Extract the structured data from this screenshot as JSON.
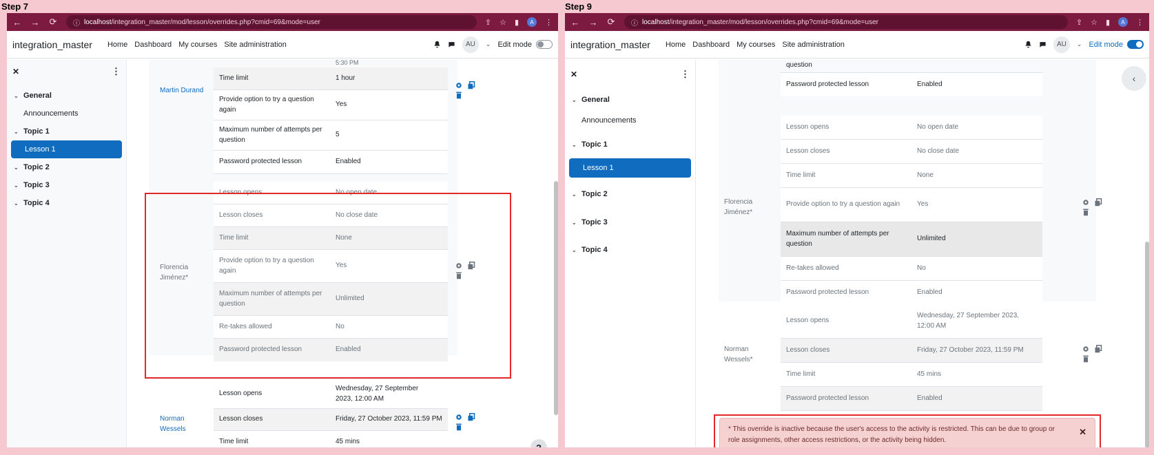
{
  "steps": [
    {
      "label": "Step 7",
      "url": {
        "host": "localhost",
        "path": "/integration_master/mod/lesson/overrides.php?cmid=69&mode=user"
      },
      "profile_initial": "A",
      "nav": {
        "site_name": "integration_master",
        "links": [
          "Home",
          "Dashboard",
          "My courses",
          "Site administration"
        ],
        "user_initials": "AU",
        "edit_mode_label": "Edit mode",
        "edit_mode_on": false
      },
      "drawer": {
        "close_glyph": "✕",
        "kebab_glyph": "⋮",
        "items": [
          {
            "label": "General",
            "type": "section"
          },
          {
            "label": "Announcements",
            "type": "child"
          },
          {
            "label": "Topic 1",
            "type": "section"
          },
          {
            "label": "Lesson 1",
            "type": "active"
          },
          {
            "label": "Topic 2",
            "type": "section"
          },
          {
            "label": "Topic 3",
            "type": "section"
          },
          {
            "label": "Topic 4",
            "type": "section"
          }
        ]
      },
      "top_fragment": "5:30 PM",
      "martin": {
        "name": "Martin Durand",
        "rows": [
          {
            "label": "Time limit",
            "value": "1 hour"
          },
          {
            "label": "Provide option to try a question again",
            "value": "Yes"
          },
          {
            "label": "Maximum number of attempts per question",
            "value": "5"
          },
          {
            "label": "Password protected lesson",
            "value": "Enabled"
          }
        ]
      },
      "florencia": {
        "name": "Florencia Jiménez*",
        "rows": [
          {
            "label": "Lesson opens",
            "value": "No open date"
          },
          {
            "label": "Lesson closes",
            "value": "No close date"
          },
          {
            "label": "Time limit",
            "value": "None"
          },
          {
            "label": "Provide option to try a question again",
            "value": "Yes"
          },
          {
            "label": "Maximum number of attempts per question",
            "value": "Unlimited"
          },
          {
            "label": "Re-takes allowed",
            "value": "No"
          },
          {
            "label": "Password protected lesson",
            "value": "Enabled"
          }
        ]
      },
      "norman": {
        "name": "Norman Wessels",
        "rows": [
          {
            "label": "Lesson opens",
            "value": "Wednesday, 27 September 2023, 12:00 AM"
          },
          {
            "label": "Lesson closes",
            "value": "Friday, 27 October 2023, 11:59 PM"
          },
          {
            "label": "Time limit",
            "value": "45 mins"
          }
        ]
      },
      "help_glyph": "?"
    },
    {
      "label": "Step 9",
      "url": {
        "host": "localhost",
        "path": "/integration_master/mod/lesson/overrides.php?cmid=69&mode=user"
      },
      "profile_initial": "A",
      "nav": {
        "site_name": "integration_master",
        "links": [
          "Home",
          "Dashboard",
          "My courses",
          "Site administration"
        ],
        "user_initials": "AU",
        "edit_mode_label": "Edit mode",
        "edit_mode_on": true
      },
      "drawer": {
        "close_glyph": "✕",
        "kebab_glyph": "⋮",
        "items": [
          {
            "label": "General",
            "type": "section"
          },
          {
            "label": "Announcements",
            "type": "child"
          },
          {
            "label": "Topic 1",
            "type": "section"
          },
          {
            "label": "Lesson 1",
            "type": "active"
          },
          {
            "label": "Topic 2",
            "type": "section"
          },
          {
            "label": "Topic 3",
            "type": "section"
          },
          {
            "label": "Topic 4",
            "type": "section"
          }
        ]
      },
      "top_fragment": "question",
      "prev_rows": [
        {
          "label": "Password protected lesson",
          "value": "Enabled"
        }
      ],
      "florencia": {
        "name": "Florencia Jiménez*",
        "rows": [
          {
            "label": "Lesson opens",
            "value": "No open date"
          },
          {
            "label": "Lesson closes",
            "value": "No close date"
          },
          {
            "label": "Time limit",
            "value": "None"
          },
          {
            "label": "Provide option to try a question again",
            "value": "Yes"
          },
          {
            "label": "Maximum number of attempts per question",
            "value": "Unlimited"
          },
          {
            "label": "Re-takes allowed",
            "value": "No"
          },
          {
            "label": "Password protected lesson",
            "value": "Enabled"
          }
        ]
      },
      "norman": {
        "name": "Norman Wessels*",
        "rows": [
          {
            "label": "Lesson opens",
            "value": "Wednesday, 27 September 2023, 12:00 AM"
          },
          {
            "label": "Lesson closes",
            "value": "Friday, 27 October 2023, 11:59 PM"
          },
          {
            "label": "Time limit",
            "value": "45 mins"
          },
          {
            "label": "Password protected lesson",
            "value": "Enabled"
          }
        ]
      },
      "alert": {
        "text": "* This override is inactive because the user's access to the activity is restricted. This can be due to group or role assignments, other access restrictions, or the activity being hidden.",
        "close_glyph": "✕"
      },
      "drawer_toggle_glyph": "‹"
    }
  ]
}
